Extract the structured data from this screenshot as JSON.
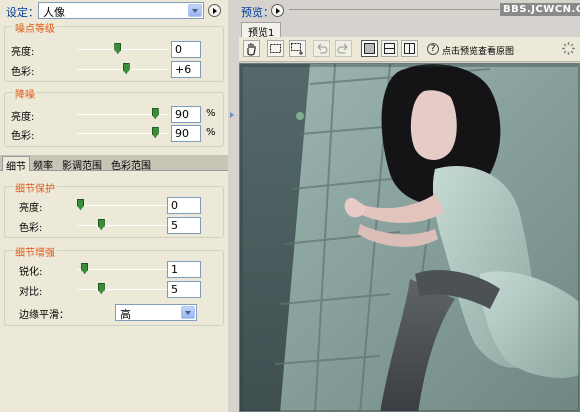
{
  "settings": {
    "label": "设定：",
    "preset": "人像"
  },
  "black_point": {
    "title": "噪点等级",
    "rows": [
      {
        "label": "亮度:",
        "value": "0",
        "level": 0.45
      },
      {
        "label": "色彩:",
        "value": "+6",
        "level": 0.55
      }
    ]
  },
  "reduce": {
    "title": "降噪",
    "rows": [
      {
        "label": "亮度:",
        "value": "90",
        "unit": "%",
        "level": 0.9
      },
      {
        "label": "色彩:",
        "value": "90",
        "unit": "%",
        "level": 0.9
      }
    ]
  },
  "tabs": [
    "细节",
    "频率",
    "影调范围",
    "色彩范围"
  ],
  "detail_protect": {
    "title": "细节保护",
    "rows": [
      {
        "label": "亮度:",
        "value": "0",
        "level": 0.0
      },
      {
        "label": "色彩:",
        "value": "5",
        "level": 0.25
      }
    ]
  },
  "detail_enhance": {
    "title": "细节增强",
    "rows": [
      {
        "label": "锐化:",
        "value": "1",
        "level": 0.05
      },
      {
        "label": "对比:",
        "value": "5",
        "level": 0.25
      }
    ],
    "edge_label": "边缘平滑：",
    "edge_value": "高"
  },
  "preview": {
    "label": "预览：",
    "watermark": "BBS.JCWCN.COM",
    "doc_tab": "预览1",
    "toolbar_caption": "点击预览查看原图",
    "help": "?"
  },
  "icons": {
    "hand": "hand-icon",
    "marquee": "marquee-icon",
    "marquee_plus": "marquee-add-icon",
    "undo": "undo-icon",
    "redo": "redo-icon",
    "single_view": "single-view-icon",
    "split_h": "split-horizontal-icon",
    "split_v": "split-vertical-icon",
    "loading": "spinner-icon"
  },
  "colors": {
    "group_title": "#e05a16",
    "label_blue": "#003c9b",
    "thumb": "#3a8e3a"
  }
}
